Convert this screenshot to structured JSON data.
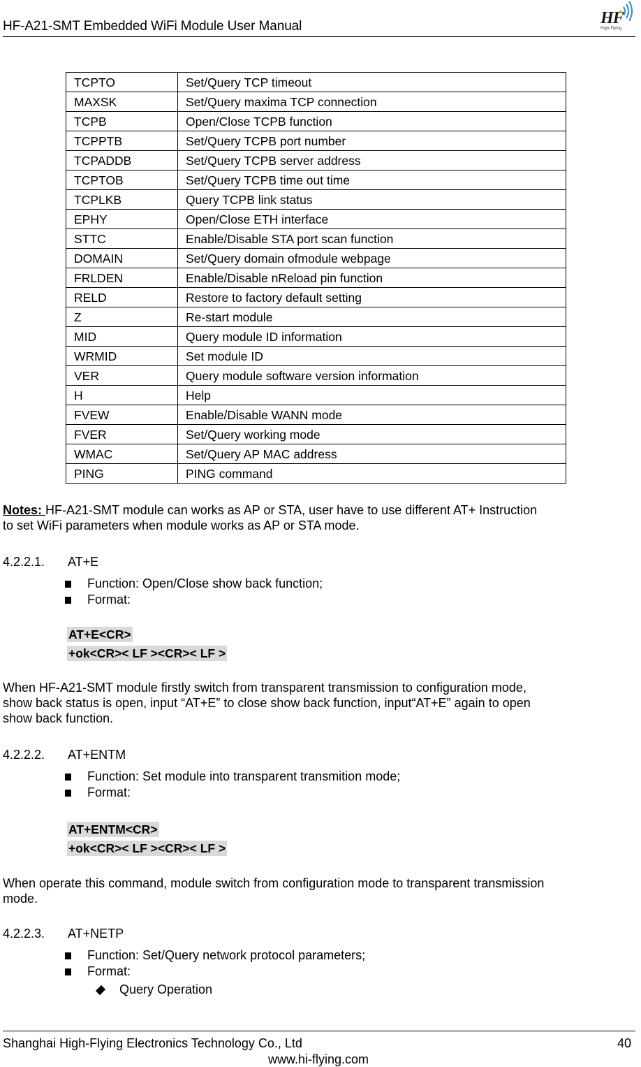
{
  "header": {
    "title": "HF-A21-SMT  Embedded WiFi Module User Manual",
    "logo": {
      "text": "HF",
      "subtext": "High-Flying",
      "icon": "wifi-waves-icon"
    }
  },
  "command_table": {
    "rows": [
      {
        "command": "TCPTO",
        "description": "Set/Query TCP timeout"
      },
      {
        "command": "MAXSK",
        "description": "Set/Query maxima TCP connection"
      },
      {
        "command": "TCPB",
        "description": "Open/Close TCPB function"
      },
      {
        "command": "TCPPTB",
        "description": "Set/Query TCPB port number"
      },
      {
        "command": "TCPADDB",
        "description": "Set/Query TCPB server address"
      },
      {
        "command": "TCPTOB",
        "description": "Set/Query TCPB time out time"
      },
      {
        "command": "TCPLKB",
        "description": "Query TCPB link status"
      },
      {
        "command": "EPHY",
        "description": "Open/Close ETH interface"
      },
      {
        "command": "STTC",
        "description": "Enable/Disable STA port scan function"
      },
      {
        "command": "DOMAIN",
        "description": "Set/Query domain ofmodule webpage"
      },
      {
        "command": "FRLDEN",
        "description": "Enable/Disable nReload pin function"
      },
      {
        "command": "RELD",
        "description": "Restore to factory default setting"
      },
      {
        "command": "Z",
        "description": "Re-start module"
      },
      {
        "command": "MID",
        "description": "Query module ID information"
      },
      {
        "command": "WRMID",
        "description": "Set module ID"
      },
      {
        "command": "VER",
        "description": "Query module software version information"
      },
      {
        "command": "H",
        "description": "Help"
      },
      {
        "command": "FVEW",
        "description": "Enable/Disable WANN mode"
      },
      {
        "command": "FVER",
        "description": "Set/Query working mode"
      },
      {
        "command": "WMAC",
        "description": "Set/Query AP MAC address"
      },
      {
        "command": "PING",
        "description": "PING command"
      }
    ]
  },
  "notes": {
    "label": "Notes: ",
    "line1": "HF-A21-SMT module can works as AP or STA, user have to use different AT+ Instruction",
    "line2": "to set WiFi parameters when module works as AP or STA mode."
  },
  "sections": [
    {
      "number": "4.2.2.1.",
      "title": "AT+E",
      "bullets": [
        "Function: Open/Close show back function;",
        "Format:"
      ],
      "code": [
        "AT+E<CR>",
        "+ok<CR>< LF ><CR>< LF >"
      ],
      "description": [
        "When HF-A21-SMT module firstly switch from transparent transmission to configuration mode,",
        "show back status is open, input “AT+E” to close show back function, input“AT+E” again to open",
        "show back function."
      ]
    },
    {
      "number": "4.2.2.2.",
      "title": "AT+ENTM",
      "bullets": [
        "Function: Set module into transparent transmition mode;",
        "Format:"
      ],
      "code": [
        "AT+ENTM<CR>",
        "+ok<CR>< LF ><CR>< LF >"
      ],
      "description": [
        "When operate this command, module switch from configuration mode to transparent transmission",
        "mode."
      ]
    },
    {
      "number": "4.2.2.3.",
      "title": "AT+NETP",
      "bullets": [
        "Function: Set/Query network protocol parameters;",
        "Format:"
      ],
      "sub_bullets": [
        "Query Operation"
      ]
    }
  ],
  "footer": {
    "company": "Shanghai High-Flying Electronics Technology Co., Ltd",
    "url": "www.hi-flying.com",
    "page_number": "40"
  }
}
